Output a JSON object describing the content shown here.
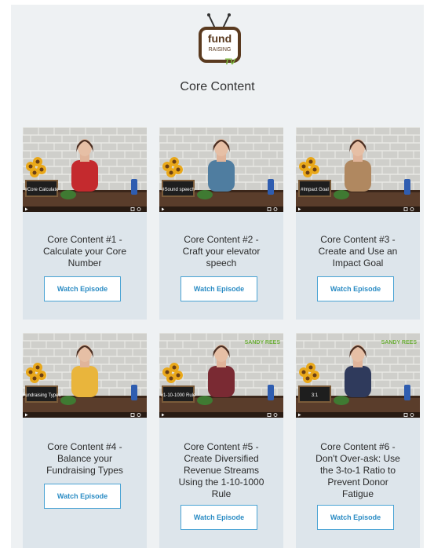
{
  "logo": {
    "top_word": "fund",
    "middle_word": "RAISING",
    "bottom_word": "TV"
  },
  "page_title": "Core Content",
  "button_label": "Watch Episode",
  "episodes": [
    {
      "title": "Core Content #1 -\nCalculate your Core\nNumber",
      "chalkboard": "#Core Calculate",
      "shirt_color": "#c42a2e",
      "banner": ""
    },
    {
      "title": "Core Content #2 -\nCraft your elevator\nspeech",
      "chalkboard": "#Sound speech",
      "shirt_color": "#4f7da0",
      "banner": ""
    },
    {
      "title": "Core Content #3 -\nCreate and Use an\nImpact Goal",
      "chalkboard": "#Impact Goal",
      "shirt_color": "#b08860",
      "banner": ""
    },
    {
      "title": "Core Content #4 -\nBalance your\nFundraising Types",
      "chalkboard": "Fundraising Types",
      "shirt_color": "#e9b53c",
      "banner": ""
    },
    {
      "title": "Core Content #5 -\nCreate Diversified\nRevenue Streams\nUsing the 1-10-1000\nRule",
      "chalkboard": "#1-10-1000 Rule",
      "shirt_color": "#7a2a33",
      "banner": "SANDY REES"
    },
    {
      "title": "Core Content #6 -\nDon't Over-ask: Use\nthe 3-to-1 Ratio to\nPrevent Donor\nFatigue",
      "chalkboard": "3:1",
      "shirt_color": "#2f3a5c",
      "banner": "SANDY REES"
    }
  ],
  "colors": {
    "page_bg": "#eef1f3",
    "card_bg": "#dde5eb",
    "button_border": "#4aa3d4",
    "button_text": "#2b8cc4",
    "logo_brown": "#5a3a1f",
    "logo_green": "#7ab83a"
  }
}
